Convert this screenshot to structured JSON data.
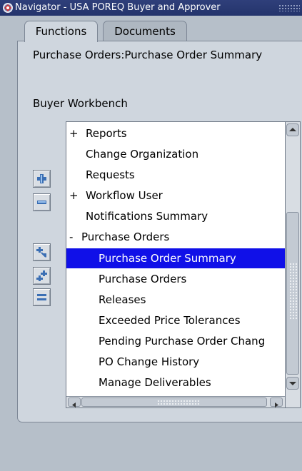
{
  "window": {
    "title": "Navigator - USA POREQ Buyer and Approver",
    "icon": "oracle-app-icon"
  },
  "tabs": [
    {
      "label": "Functions",
      "active": true
    },
    {
      "label": "Documents",
      "active": false
    }
  ],
  "context": {
    "current_function": "Purchase Orders:Purchase Order Summary",
    "responsibility": "Buyer Workbench"
  },
  "toolbar_buttons": [
    {
      "name": "expand-one",
      "icon": "plus-icon"
    },
    {
      "name": "collapse-one",
      "icon": "minus-icon"
    },
    {
      "name": "expand-branch",
      "icon": "expand-branch-icon"
    },
    {
      "name": "expand-all",
      "icon": "expand-all-icon"
    },
    {
      "name": "collapse-all",
      "icon": "collapse-all-icon"
    }
  ],
  "tree": {
    "items": [
      {
        "prefix": "+",
        "label": "Reports",
        "indent": 0
      },
      {
        "prefix": "",
        "label": "Change Organization",
        "indent": 0
      },
      {
        "prefix": "",
        "label": "Requests",
        "indent": 0
      },
      {
        "prefix": "+",
        "label": "Workflow User",
        "indent": 0
      },
      {
        "prefix": "",
        "label": "Notifications Summary",
        "indent": 0
      },
      {
        "prefix": "-",
        "label": "Purchase Orders",
        "indent": 0
      },
      {
        "prefix": "",
        "label": "Purchase Order Summary",
        "indent": 1,
        "selected": true
      },
      {
        "prefix": "",
        "label": "Purchase Orders",
        "indent": 1
      },
      {
        "prefix": "",
        "label": "Releases",
        "indent": 1
      },
      {
        "prefix": "",
        "label": "Exceeded Price Tolerances",
        "indent": 1
      },
      {
        "prefix": "",
        "label": "Pending Purchase Order Chang",
        "indent": 1
      },
      {
        "prefix": "",
        "label": "PO Change History",
        "indent": 1
      },
      {
        "prefix": "",
        "label": "Manage Deliverables",
        "indent": 1
      }
    ]
  },
  "colors": {
    "selection": "#1010e8",
    "titlebar": "#24346c",
    "panel": "#cfd6de",
    "background": "#b6bfc9"
  }
}
